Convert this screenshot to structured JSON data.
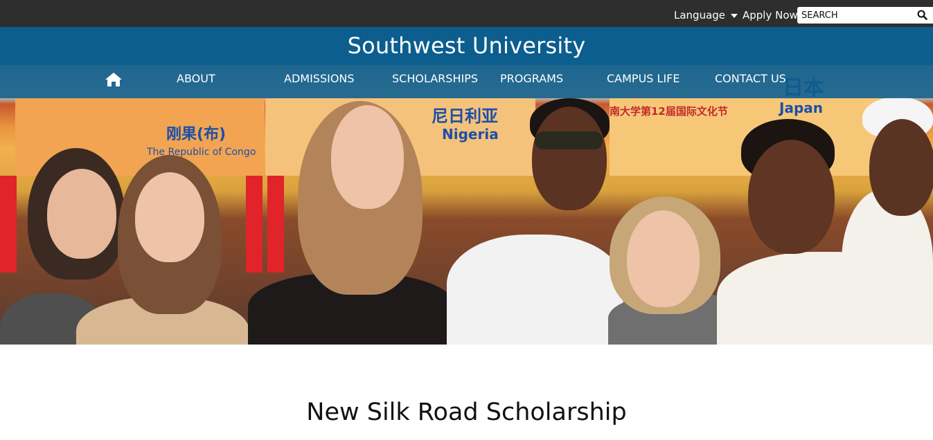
{
  "topbar": {
    "language_label": "Language",
    "apply_label": "Apply Now",
    "search_placeholder": "SEARCH"
  },
  "header": {
    "site_title": "Southwest University"
  },
  "nav": {
    "items": [
      {
        "label": "ABOUT"
      },
      {
        "label": "ADMISSIONS"
      },
      {
        "label": "SCHOLARSHIPS"
      },
      {
        "label": "PROGRAMS"
      },
      {
        "label": "CAMPUS LIFE"
      },
      {
        "label": "CONTACT US"
      }
    ]
  },
  "hero": {
    "banner_1": "刚果(布)",
    "banner_1_sub": "The Republic of Congo",
    "banner_2": "尼日利亚",
    "banner_2_sub": "Nigeria",
    "banner_3": "日本",
    "banner_3_sub": "Japan",
    "festival_text": "南大学第12届国际文化节"
  },
  "main": {
    "page_title": "New Silk Road Scholarship"
  },
  "colors": {
    "topbar_bg": "#2e2e2e",
    "header_bg": "#0b5e8e",
    "nav_bg": "#0e5e8c"
  },
  "icons": {
    "home": "home-icon",
    "search": "search-icon",
    "language_caret": "chevron-down-icon"
  }
}
